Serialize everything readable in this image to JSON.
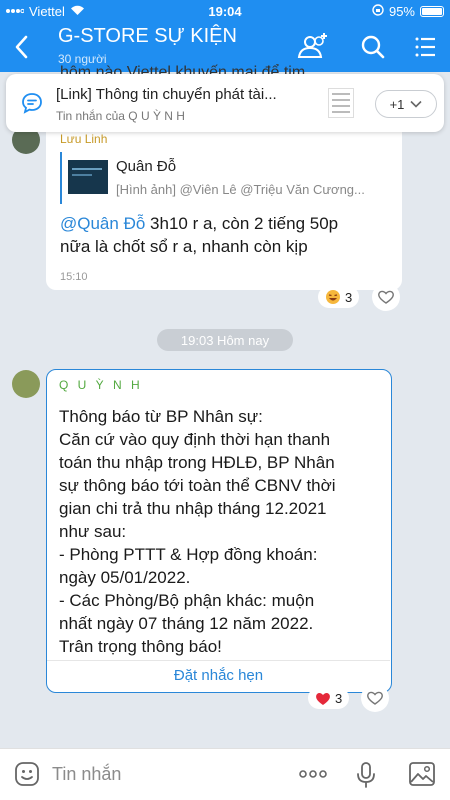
{
  "status_bar": {
    "carrier": "Viettel",
    "time": "19:04",
    "battery": "95%"
  },
  "header": {
    "title": "G-STORE SỰ KIỆN",
    "subtitle": "30 người"
  },
  "pinned": {
    "title": "[Link] Thông tin chuyển phát tài...",
    "subtitle": "Tin nhắn của Q U Ỳ N H",
    "more_label": "+1",
    "hidden_line": "hôm nào Viettel khuyến mại để tim"
  },
  "message1": {
    "sender": "Lưu Linh",
    "quote_name": "Quân Đỗ",
    "quote_text": "[Hình ảnh] @Viên Lê @Triệu Văn Cương...",
    "mention": "@Quân Đỗ",
    "text_line1": "3h10 r a, còn 2 tiếng 50p",
    "text_line2": "nữa là chốt sổ r a, nhanh còn kịp",
    "time": "15:10",
    "reaction_count": "3"
  },
  "time_divider": "19:03 Hôm nay",
  "message2": {
    "sender": "Q U Ỳ N H",
    "lines": [
      "Thông báo từ BP Nhân sự:",
      "Căn cứ vào quy định thời hạn thanh",
      "toán thu nhập trong HĐLĐ, BP Nhân",
      "sự thông báo tới toàn thể CBNV thời",
      "gian chi trả thu nhập tháng 12.2021",
      "như sau:",
      "-  Phòng PTTT & Hợp đồng khoán:",
      "ngày 05/01/2022.",
      "- Các Phòng/Bộ phận khác: muộn",
      "nhất ngày 07 tháng 12 năm 2022.",
      "Trân trọng thông báo!"
    ],
    "remind_label": "Đặt nhắc hẹn",
    "reaction_count": "3"
  },
  "composer": {
    "placeholder": "Tin nhắn"
  },
  "colors": {
    "brand": "#1f8ef1",
    "link": "#2a87d8",
    "sender_green": "#53a940",
    "sender_gold": "#c79a28"
  }
}
